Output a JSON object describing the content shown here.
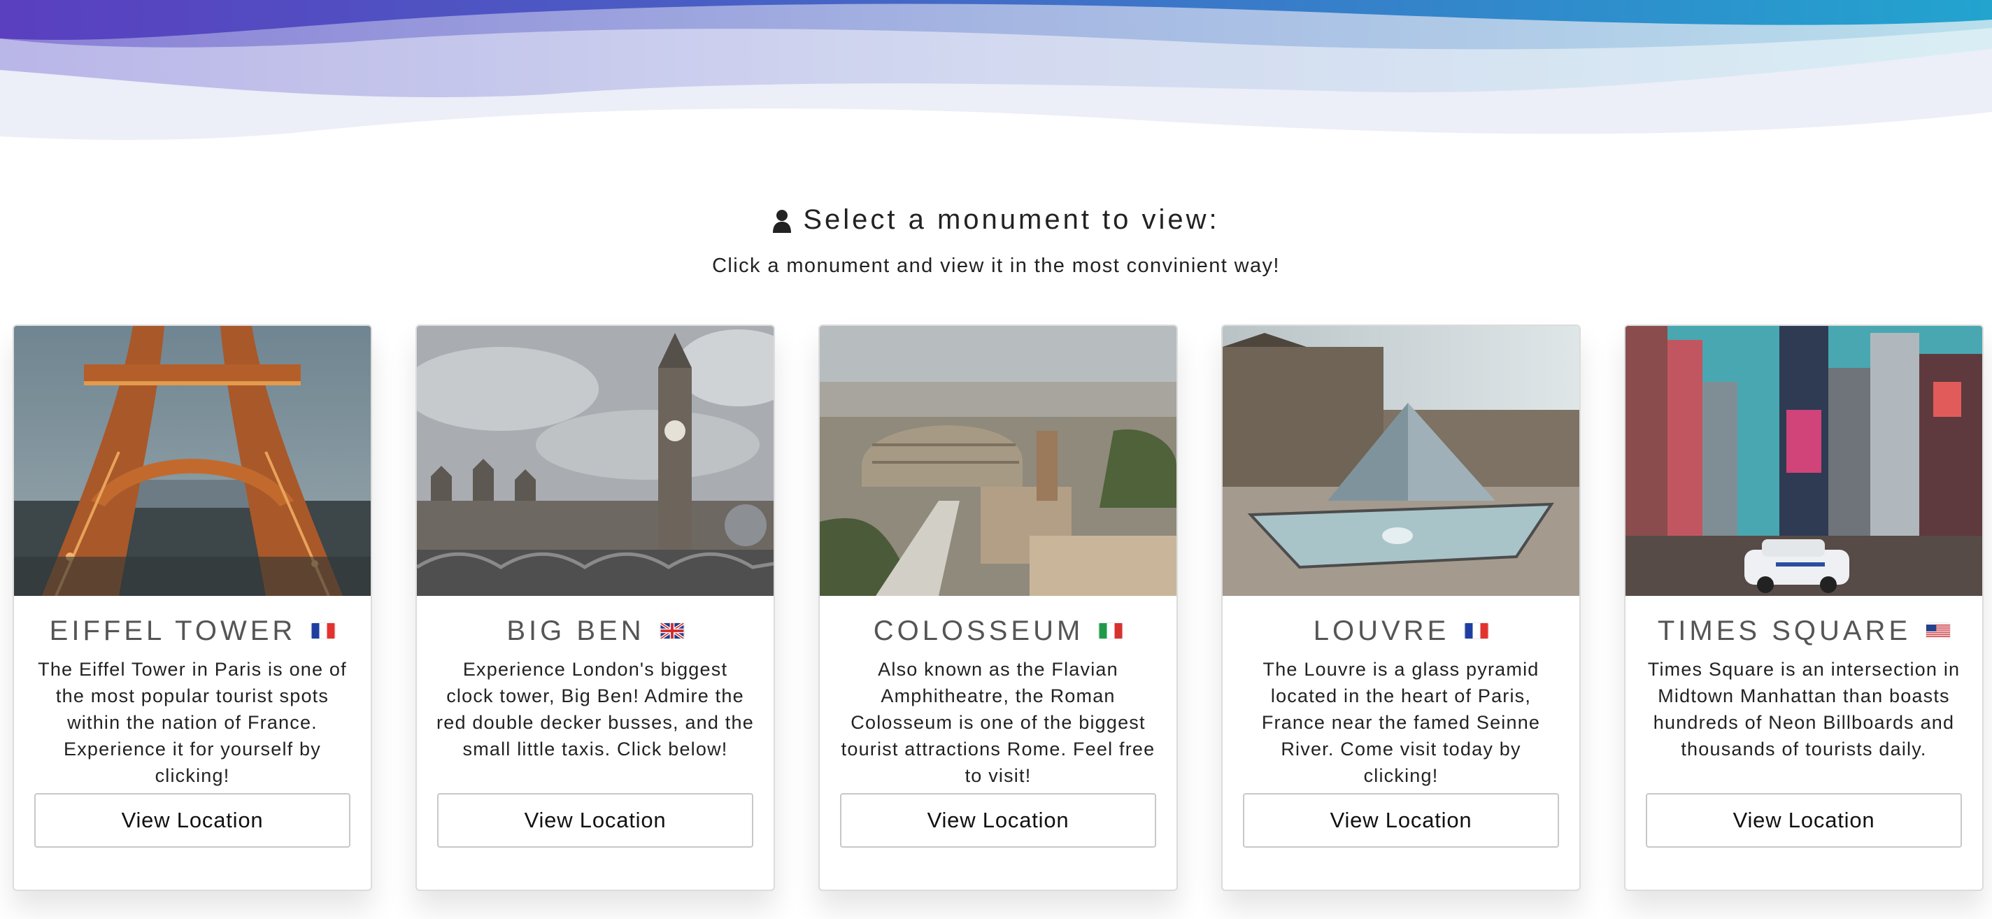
{
  "colors": {
    "wave_purple": "#5b3fc0",
    "wave_blue": "#3f7bc9",
    "wave_teal": "#2aa3cf",
    "wave_light": "#eceef8",
    "text_dark": "#222222",
    "title_gray": "#555555"
  },
  "intro": {
    "icon": "user-icon",
    "title": "Select a monument to view:",
    "subtitle": "Click a monument and view it in the most convinient way!"
  },
  "cards": [
    {
      "title": "Eiffel Tower",
      "flag": "flag-france-icon",
      "image": "eiffel-tower-photo",
      "description": "The Eiffel Tower in Paris is one of the most popular tourist spots within the nation of France. Experience it for yourself by clicking!",
      "button_label": "View Location"
    },
    {
      "title": "Big Ben",
      "flag": "flag-uk-icon",
      "image": "big-ben-photo",
      "description": "Experience London's biggest clock tower, Big Ben! Admire the red double decker busses, and the small little taxis. Click below!",
      "button_label": "View Location"
    },
    {
      "title": "Colosseum",
      "flag": "flag-italy-icon",
      "image": "colosseum-photo",
      "description": "Also known as the Flavian Amphitheatre, the Roman Colosseum is one of the biggest tourist attractions Rome. Feel free to visit!",
      "button_label": "View Location"
    },
    {
      "title": "Louvre",
      "flag": "flag-france-icon",
      "image": "louvre-photo",
      "description": "The Louvre is a glass pyramid located in the heart of Paris, France near the famed Seinne River. Come visit today by clicking!",
      "button_label": "View Location"
    },
    {
      "title": "Times Square",
      "flag": "flag-usa-icon",
      "image": "times-square-photo",
      "description": "Times Square is an intersection in Midtown Manhattan than boasts hundreds of Neon Billboards and thousands of tourists daily.",
      "button_label": "View Location"
    }
  ]
}
